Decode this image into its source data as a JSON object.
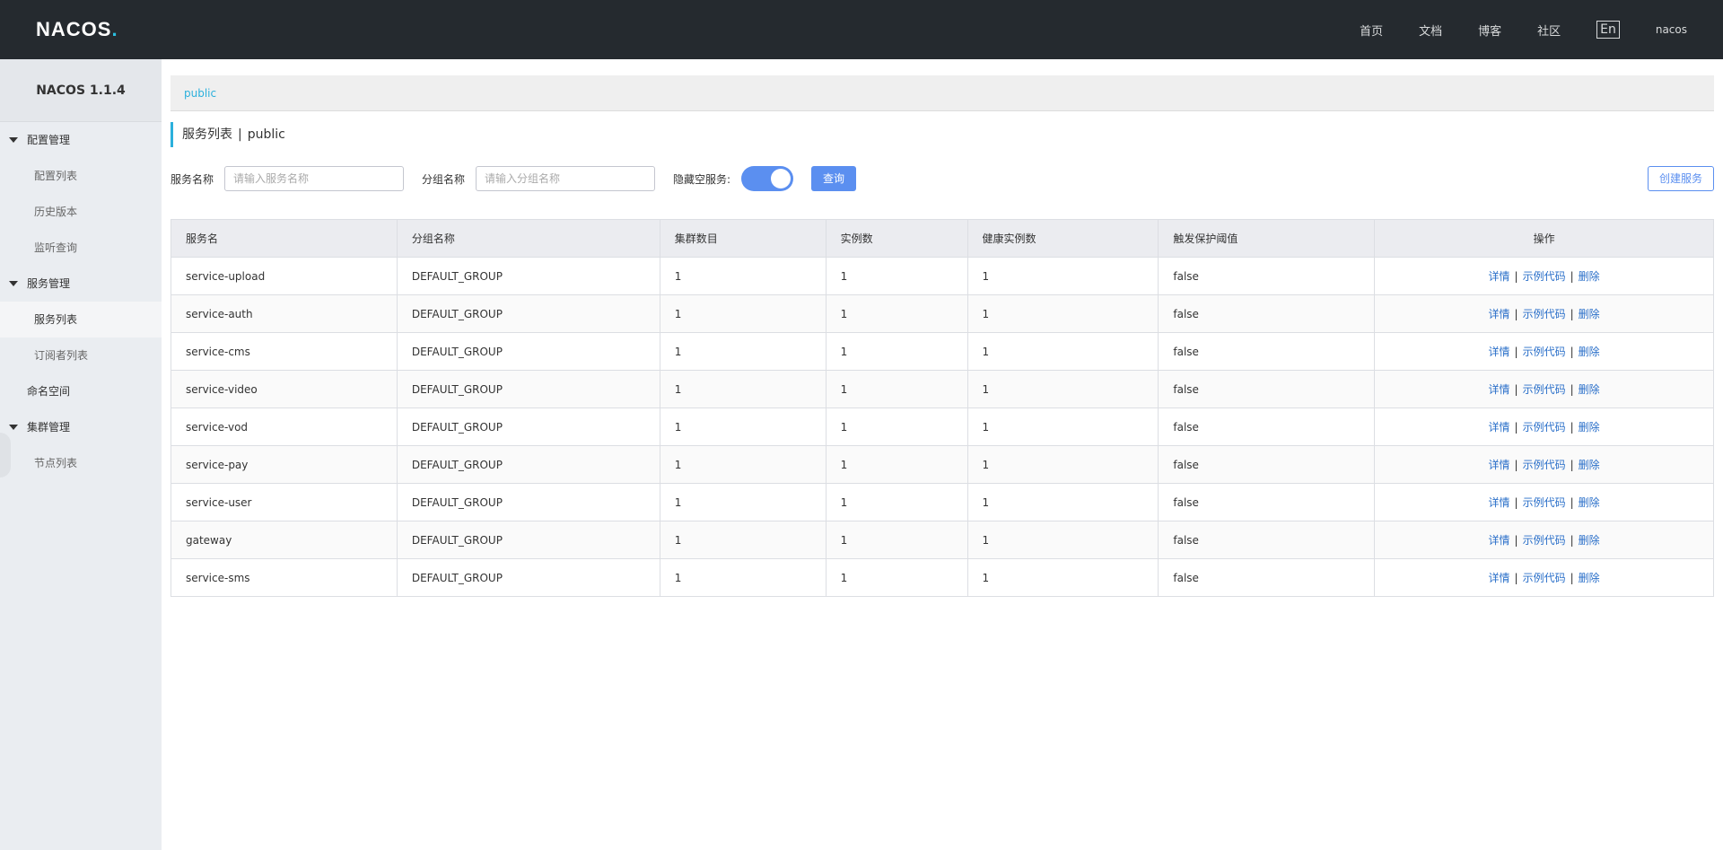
{
  "header": {
    "logo_main": "NACOS",
    "logo_dot": ".",
    "nav": [
      "首页",
      "文档",
      "博客",
      "社区"
    ],
    "lang": "En",
    "user": "nacos"
  },
  "sidebar": {
    "version": "NACOS 1.1.4",
    "config_group": "配置管理",
    "config_items": [
      "配置列表",
      "历史版本",
      "监听查询"
    ],
    "service_group": "服务管理",
    "service_items": [
      "服务列表",
      "订阅者列表"
    ],
    "namespace": "命名空间",
    "cluster_group": "集群管理",
    "cluster_items": [
      "节点列表"
    ]
  },
  "breadcrumb": {
    "namespace": "public"
  },
  "page_title": {
    "title": "服务列表",
    "sep": "|",
    "namespace": "public"
  },
  "filter": {
    "service_name_label": "服务名称",
    "service_name_placeholder": "请输入服务名称",
    "group_name_label": "分组名称",
    "group_name_placeholder": "请输入分组名称",
    "hide_empty_label": "隐藏空服务:",
    "hide_empty_on": true,
    "query_label": "查询",
    "create_label": "创建服务"
  },
  "table": {
    "headers": [
      "服务名",
      "分组名称",
      "集群数目",
      "实例数",
      "健康实例数",
      "触发保护阈值",
      "操作"
    ],
    "rows": [
      {
        "name": "service-upload",
        "group": "DEFAULT_GROUP",
        "clusters": "1",
        "instances": "1",
        "healthy": "1",
        "threshold": "false"
      },
      {
        "name": "service-auth",
        "group": "DEFAULT_GROUP",
        "clusters": "1",
        "instances": "1",
        "healthy": "1",
        "threshold": "false"
      },
      {
        "name": "service-cms",
        "group": "DEFAULT_GROUP",
        "clusters": "1",
        "instances": "1",
        "healthy": "1",
        "threshold": "false"
      },
      {
        "name": "service-video",
        "group": "DEFAULT_GROUP",
        "clusters": "1",
        "instances": "1",
        "healthy": "1",
        "threshold": "false"
      },
      {
        "name": "service-vod",
        "group": "DEFAULT_GROUP",
        "clusters": "1",
        "instances": "1",
        "healthy": "1",
        "threshold": "false"
      },
      {
        "name": "service-pay",
        "group": "DEFAULT_GROUP",
        "clusters": "1",
        "instances": "1",
        "healthy": "1",
        "threshold": "false"
      },
      {
        "name": "service-user",
        "group": "DEFAULT_GROUP",
        "clusters": "1",
        "instances": "1",
        "healthy": "1",
        "threshold": "false"
      },
      {
        "name": "gateway",
        "group": "DEFAULT_GROUP",
        "clusters": "1",
        "instances": "1",
        "healthy": "1",
        "threshold": "false"
      },
      {
        "name": "service-sms",
        "group": "DEFAULT_GROUP",
        "clusters": "1",
        "instances": "1",
        "healthy": "1",
        "threshold": "false"
      }
    ],
    "ops": {
      "detail": "详情",
      "sample": "示例代码",
      "delete": "删除",
      "sep": "|"
    }
  },
  "colors": {
    "header_bg": "#252a2f",
    "accent": "#5b8ff0",
    "link": "#2a6fc9",
    "breadcrumb": "#2bb0dc"
  }
}
